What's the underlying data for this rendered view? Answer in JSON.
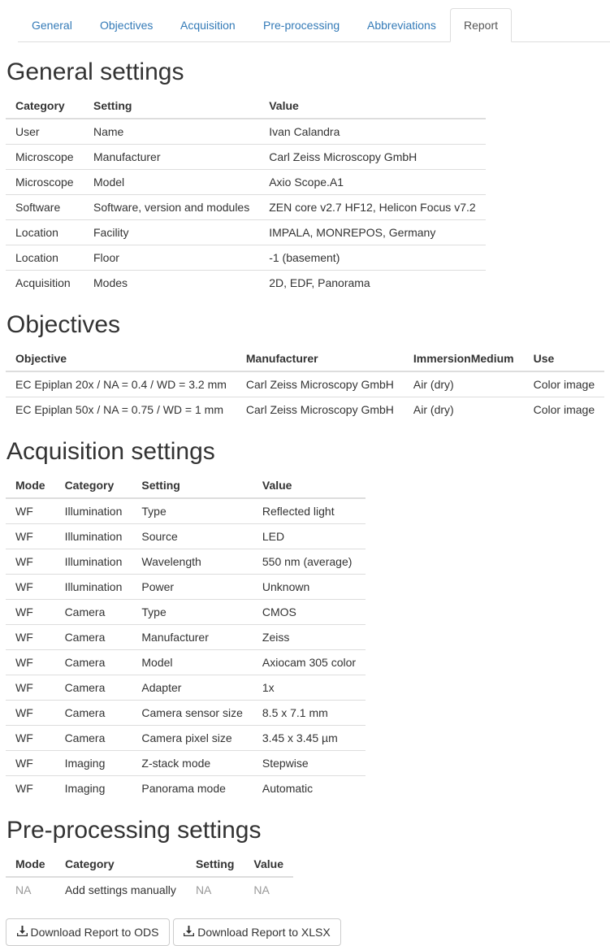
{
  "tabs": [
    "General",
    "Objectives",
    "Acquisition",
    "Pre-processing",
    "Abbreviations",
    "Report"
  ],
  "active_tab": "Report",
  "general": {
    "title": "General settings",
    "headers": [
      "Category",
      "Setting",
      "Value"
    ],
    "rows": [
      [
        "User",
        "Name",
        "Ivan Calandra"
      ],
      [
        "Microscope",
        "Manufacturer",
        "Carl Zeiss Microscopy GmbH"
      ],
      [
        "Microscope",
        "Model",
        "Axio Scope.A1"
      ],
      [
        "Software",
        "Software, version and modules",
        "ZEN core v2.7 HF12, Helicon Focus v7.2"
      ],
      [
        "Location",
        "Facility",
        "IMPALA, MONREPOS, Germany"
      ],
      [
        "Location",
        "Floor",
        "-1 (basement)"
      ],
      [
        "Acquisition",
        "Modes",
        "2D, EDF, Panorama"
      ]
    ]
  },
  "objectives": {
    "title": "Objectives",
    "headers": [
      "Objective",
      "Manufacturer",
      "ImmersionMedium",
      "Use"
    ],
    "rows": [
      [
        "EC Epiplan 20x / NA = 0.4 / WD = 3.2 mm",
        "Carl Zeiss Microscopy GmbH",
        "Air (dry)",
        "Color image"
      ],
      [
        "EC Epiplan 50x / NA = 0.75 / WD = 1 mm",
        "Carl Zeiss Microscopy GmbH",
        "Air (dry)",
        "Color image"
      ]
    ]
  },
  "acquisition": {
    "title": "Acquisition settings",
    "headers": [
      "Mode",
      "Category",
      "Setting",
      "Value"
    ],
    "rows": [
      [
        "WF",
        "Illumination",
        "Type",
        "Reflected light"
      ],
      [
        "WF",
        "Illumination",
        "Source",
        "LED"
      ],
      [
        "WF",
        "Illumination",
        "Wavelength",
        "550 nm (average)"
      ],
      [
        "WF",
        "Illumination",
        "Power",
        "Unknown"
      ],
      [
        "WF",
        "Camera",
        "Type",
        "CMOS"
      ],
      [
        "WF",
        "Camera",
        "Manufacturer",
        "Zeiss"
      ],
      [
        "WF",
        "Camera",
        "Model",
        "Axiocam 305 color"
      ],
      [
        "WF",
        "Camera",
        "Adapter",
        "1x"
      ],
      [
        "WF",
        "Camera",
        "Camera sensor size",
        "8.5 x 7.1 mm"
      ],
      [
        "WF",
        "Camera",
        "Camera pixel size",
        "3.45 x 3.45 µm"
      ],
      [
        "WF",
        "Imaging",
        "Z-stack mode",
        "Stepwise"
      ],
      [
        "WF",
        "Imaging",
        "Panorama mode",
        "Automatic"
      ]
    ]
  },
  "preprocessing": {
    "title": "Pre-processing settings",
    "headers": [
      "Mode",
      "Category",
      "Setting",
      "Value"
    ],
    "rows": [
      [
        "NA",
        "Add settings manually",
        "NA",
        "NA"
      ]
    ]
  },
  "buttons": {
    "ods": "Download Report to ODS",
    "xlsx": "Download Report to XLSX",
    "icon": "download-icon"
  },
  "colors": {
    "link": "#337ab7",
    "border": "#dddddd",
    "text": "#333333",
    "muted": "#999999"
  }
}
